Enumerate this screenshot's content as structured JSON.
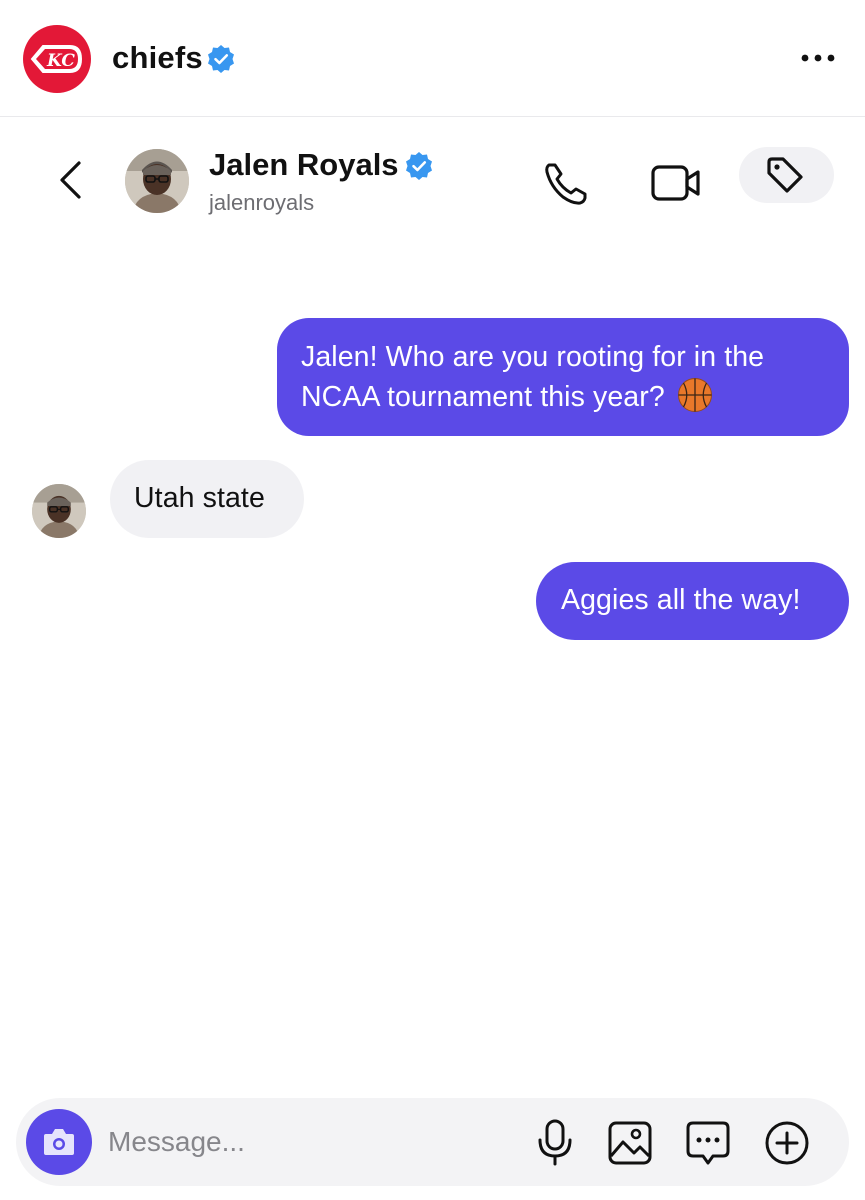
{
  "account": {
    "name": "chiefs",
    "logo_text": "KC",
    "brand_color": "#e31837"
  },
  "conversation": {
    "contact_name": "Jalen Royals",
    "contact_username": "jalenroyals"
  },
  "messages": [
    {
      "direction": "outgoing",
      "text": "Jalen! Who are you rooting for in the NCAA tournament this year?",
      "emoji": "basketball-emoji"
    },
    {
      "direction": "incoming",
      "text": "Utah state"
    },
    {
      "direction": "outgoing",
      "text": "Aggies all the way!"
    }
  ],
  "composer": {
    "placeholder": "Message..."
  },
  "icons": {
    "verified": "verified-badge-icon",
    "more": "more-horizontal-icon",
    "back": "chevron-left-icon",
    "call": "phone-icon",
    "video": "video-camera-icon",
    "tag": "tag-icon",
    "camera": "camera-icon",
    "mic": "microphone-icon",
    "image": "image-icon",
    "sticker": "message-ellipsis-icon",
    "add": "plus-circle-icon"
  },
  "colors": {
    "accent": "#5b4ae7",
    "verified": "#3897f0",
    "incoming_bubble": "#f1f1f4"
  }
}
